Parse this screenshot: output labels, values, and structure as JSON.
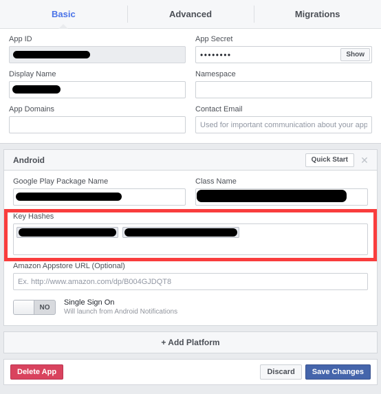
{
  "tabs": [
    {
      "label": "Basic",
      "active": true
    },
    {
      "label": "Advanced",
      "active": false
    },
    {
      "label": "Migrations",
      "active": false
    }
  ],
  "basic": {
    "app_id": {
      "label": "App ID",
      "value": "",
      "placeholder": "",
      "redacted": true
    },
    "app_secret": {
      "label": "App Secret",
      "value": "••••••••",
      "show_button": "Show"
    },
    "display_name": {
      "label": "Display Name",
      "value": "",
      "placeholder": "",
      "redacted": true
    },
    "namespace": {
      "label": "Namespace",
      "value": "",
      "placeholder": ""
    },
    "app_domains": {
      "label": "App Domains",
      "value": "",
      "placeholder": ""
    },
    "contact_email": {
      "label": "Contact Email",
      "value": "",
      "placeholder": "Used for important communication about your app"
    }
  },
  "platform": {
    "title": "Android",
    "quick_start": "Quick Start",
    "close_icon": "close-icon",
    "package_name": {
      "label": "Google Play Package Name",
      "value": "",
      "redacted": true
    },
    "class_name": {
      "label": "Class Name",
      "value": "",
      "redacted": true
    },
    "key_hashes": {
      "label": "Key Hashes",
      "tokens": [
        "",
        ""
      ],
      "highlighted": true,
      "highlight_color": "#f93d3d"
    },
    "amazon_url": {
      "label": "Amazon Appstore URL (Optional)",
      "value": "",
      "placeholder": "Ex. http://www.amazon.com/dp/B004GJDQT8"
    },
    "single_sign_on": {
      "toggle_value": "NO",
      "title": "Single Sign On",
      "subtitle": "Will launch from Android Notifications"
    }
  },
  "add_platform": {
    "label": "+ Add Platform"
  },
  "footer": {
    "delete": "Delete App",
    "discard": "Discard",
    "save": "Save Changes"
  },
  "colors": {
    "accent_blue": "#4a73e8",
    "save_blue": "#4565ab",
    "delete_red": "#d9435e",
    "highlight_red": "#f93d3d",
    "page_bg": "#e9ebee"
  }
}
